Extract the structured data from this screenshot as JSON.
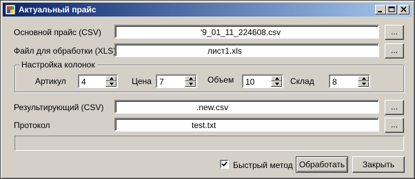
{
  "window": {
    "title": "Актуальный прайс"
  },
  "main_price": {
    "label": "Основной прайс (CSV)",
    "value": "'9_01_11_224608.csv",
    "browse": "..."
  },
  "process_file": {
    "label": "Файл для обработки (XLS)",
    "value": "лист1.xls",
    "browse": "..."
  },
  "columns": {
    "title": "Настройка колонок",
    "article": {
      "label": "Артикул",
      "value": "4"
    },
    "price": {
      "label": "Цена",
      "value": "7"
    },
    "volume": {
      "label": "Объем",
      "value": "10"
    },
    "stock": {
      "label": "Склад",
      "value": "8"
    }
  },
  "result": {
    "label": "Результирующий (CSV)",
    "value": ".new.csv",
    "browse": "..."
  },
  "log": {
    "label": "Протокол",
    "value": "test.txt",
    "browse": "..."
  },
  "progress": {
    "value": 0
  },
  "fast_method": {
    "label": "Быстрый метод",
    "checked": true
  },
  "actions": {
    "process": "Обработать",
    "close": "Закрыть"
  }
}
